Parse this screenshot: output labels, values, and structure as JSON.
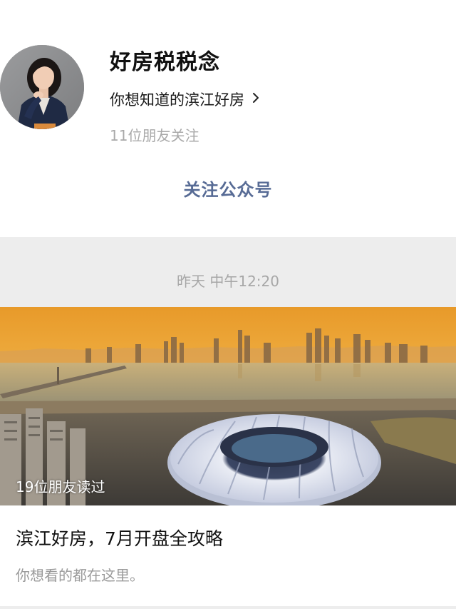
{
  "account": {
    "name": "好房税税念",
    "description": "你想知道的滨江好房",
    "followers": "11位朋友关注",
    "follow_button": "关注公众号",
    "avatar_icon": "person-portrait-icon",
    "chevron_icon": "chevron-right-icon"
  },
  "feed": {
    "timestamp": "昨天 中午12:20"
  },
  "article": {
    "read_count": "19位朋友读过",
    "title": "滨江好房，7月开盘全攻略",
    "digest": "你想看的都在这里。",
    "cover_subject": "city-skyline-river-stadium"
  },
  "colors": {
    "link_blue": "#576b95",
    "gray_text": "#a9a9a9",
    "band_gray": "#ededed"
  }
}
